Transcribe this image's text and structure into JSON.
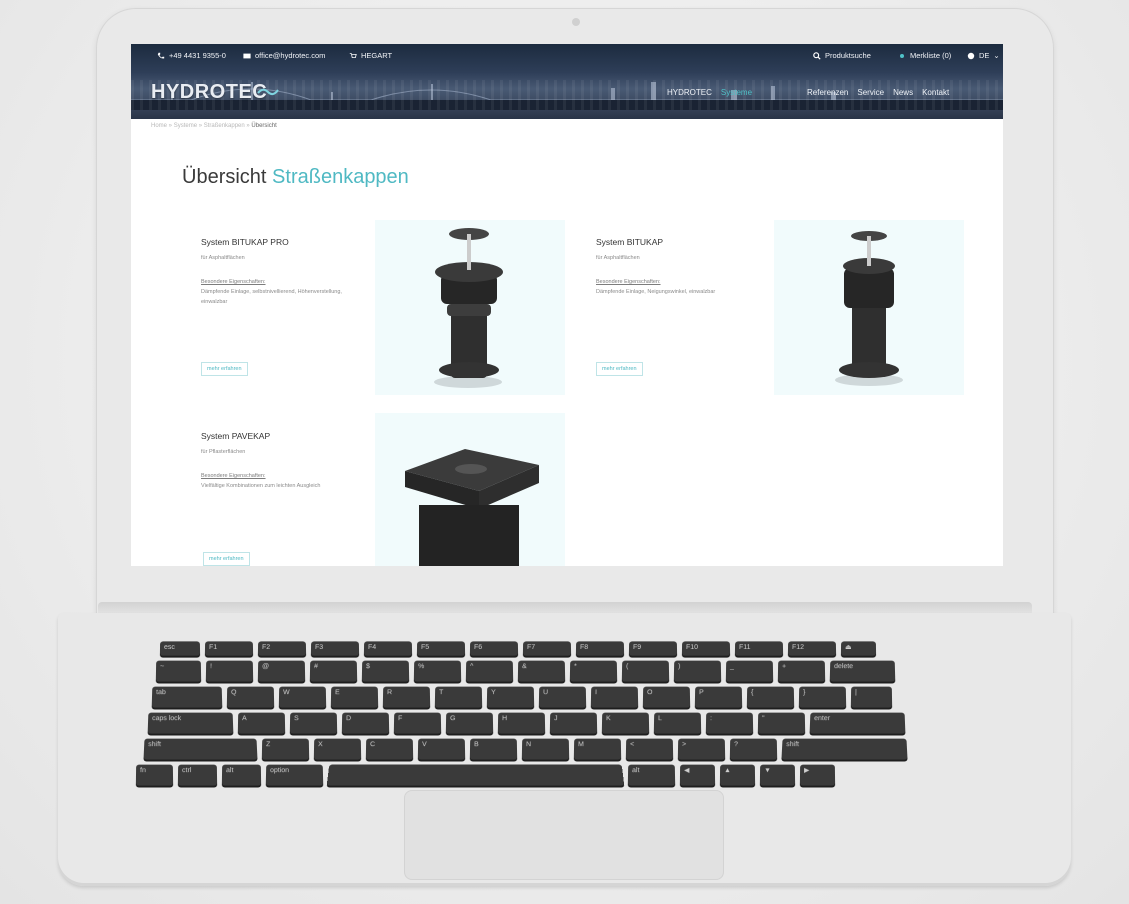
{
  "topbar": {
    "phone": "+49 4431 9355-0",
    "email": "office@hydrotec.com",
    "partner": "HEGART",
    "search": "Produktsuche",
    "merkliste": "Merkliste (0)",
    "language": "DE"
  },
  "header": {
    "logo": "HYDROTEC",
    "nav": [
      "HYDROTEC",
      "Systeme",
      "Referenzen",
      "Service",
      "News",
      "Kontakt"
    ],
    "active_nav": "Systeme"
  },
  "breadcrumb": {
    "items": [
      "Home",
      "Systeme",
      "Straßenkappen"
    ],
    "current": "Übersicht"
  },
  "page": {
    "title_main": "Übersicht",
    "title_accent": "Straßenkappen"
  },
  "products": [
    {
      "title": "System BITUKAP PRO",
      "subtitle": "für Asphaltflächen",
      "props_label": "Besondere Eigenschaften:",
      "description": "Dämpfende Einlage, selbstnivellierend, Höhenverstellung, einwalzbar",
      "button": "mehr erfahren"
    },
    {
      "title": "System BITUKAP",
      "subtitle": "für Asphaltflächen",
      "props_label": "Besondere Eigenschaften:",
      "description": "Dämpfende Einlage, Neigungswinkel, einwalzbar",
      "button": "mehr erfahren"
    },
    {
      "title": "System PAVEKAP",
      "subtitle": "für Pflasterflächen",
      "props_label": "Besondere Eigenschaften:",
      "description": "Vielfältige Kombinationen zum leichten Ausgleich",
      "button": "mehr erfahren"
    }
  ],
  "colors": {
    "accent": "#4fb9c3",
    "header_dark": "#1c2b3f",
    "laptop_body": "#e9e9e9",
    "key": "#3a3a3a"
  },
  "keyboard": {
    "row0": [
      "esc",
      "F1",
      "F2",
      "F3",
      "F4",
      "F5",
      "F6",
      "F7",
      "F8",
      "F9",
      "F10",
      "F11",
      "F12",
      "⏏"
    ],
    "row1": [
      "~",
      "!",
      "@",
      "#",
      "$",
      "%",
      "^",
      "&",
      "*",
      "(",
      ")",
      "_",
      "+",
      "delete"
    ],
    "row2": [
      "tab",
      "Q",
      "W",
      "E",
      "R",
      "T",
      "Y",
      "U",
      "I",
      "O",
      "P",
      "{",
      "}",
      "|"
    ],
    "row3": [
      "caps lock",
      "A",
      "S",
      "D",
      "F",
      "G",
      "H",
      "J",
      "K",
      "L",
      ":",
      "\"",
      "enter"
    ],
    "row4": [
      "shift",
      "Z",
      "X",
      "C",
      "V",
      "B",
      "N",
      "M",
      "<",
      ">",
      "?",
      "shift"
    ],
    "row5": [
      "fn",
      "ctrl",
      "alt",
      "option",
      "",
      "alt",
      "◀",
      "▲",
      "▼",
      "▶"
    ]
  }
}
